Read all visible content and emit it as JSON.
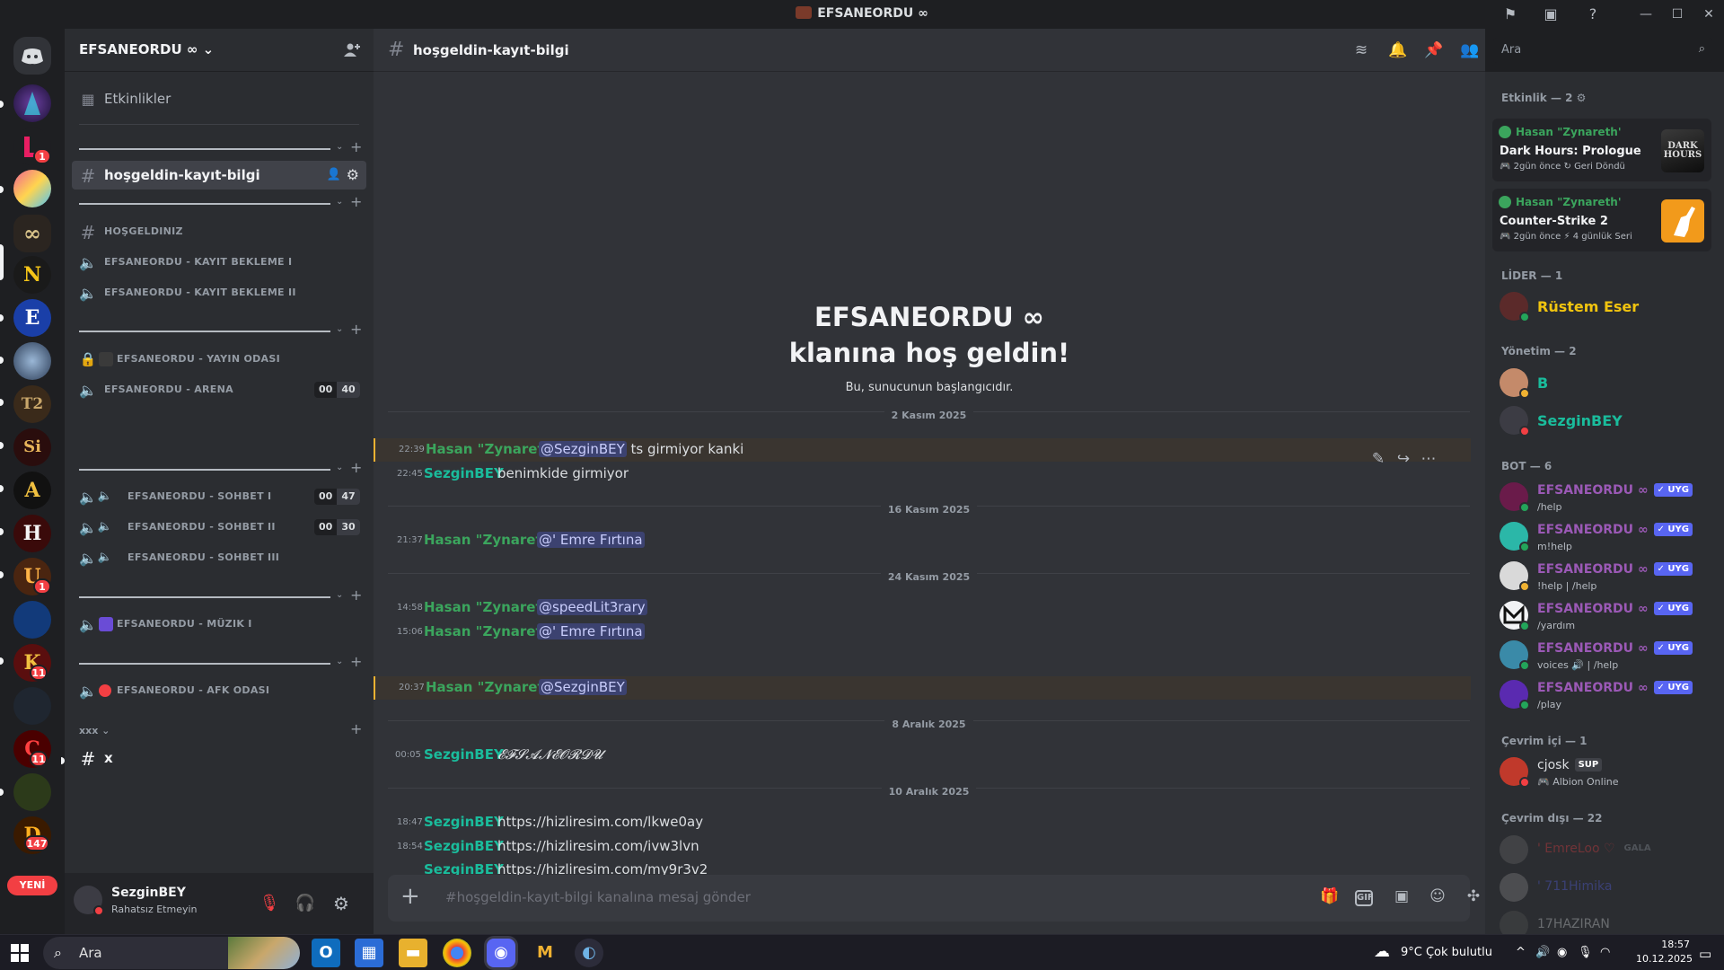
{
  "app": {
    "title": "EFSANEORDU ∞"
  },
  "server": {
    "name": "EFSANEORDU ∞"
  },
  "sidebar": {
    "events_label": "Etkinlikler",
    "selected_channel": "hoşgeldin-kayıt-bilgi",
    "channels": {
      "c1": "HOŞGELDINIZ",
      "c2": "EFSANEORDU - KAYIT BEKLEME I",
      "c3": "EFSANEORDU - KAYIT BEKLEME II",
      "c4": "EFSANEORDU - YAYIN ODASI",
      "c5": "EFSANEORDU - ARENA",
      "c6": "EFSANEORDU - SOHBET I",
      "c7": "EFSANEORDU - SOHBET II",
      "c8": "EFSANEORDU - SOHBET III",
      "c9": "EFSANEORDU - MÜZIK I",
      "c10": "EFSANEORDU - AFK ODASI",
      "c11": "x"
    },
    "counts": {
      "arena": [
        "00",
        "40"
      ],
      "sohbet1": [
        "00",
        "47"
      ],
      "sohbet2": [
        "00",
        "30"
      ]
    },
    "category_xxx": "xxx",
    "yeni_label": "YENİ"
  },
  "guild_badges": {
    "b1": "1",
    "b2": "1",
    "b3": "11",
    "b4": "11",
    "b5": "147"
  },
  "guild_letters": {
    "g1": "N",
    "g2": "E",
    "g3": "T2",
    "g4": "Si",
    "g5": "A",
    "g6": "H",
    "g7": "U",
    "g8": "K",
    "g9": "C",
    "g10": "D"
  },
  "user_panel": {
    "name": "SezginBEY",
    "status": "Rahatsız Etmeyin"
  },
  "channel_header": {
    "name": "hoşgeldin-kayıt-bilgi"
  },
  "search": {
    "placeholder": "Ara"
  },
  "welcome": {
    "line1": "EFSANEORDU ∞",
    "line2": "klanına hoş geldin!",
    "sub": "Bu, sunucunun başlangıcıdır."
  },
  "dates": {
    "d1": "2 Kasım 2025",
    "d2": "16 Kasım 2025",
    "d3": "24 Kasım 2025",
    "d4": "8 Aralık 2025",
    "d5": "10 Aralık 2025"
  },
  "messages": [
    {
      "time": "22:39",
      "author": "Hasan \"Zynareth'",
      "mention": "@SezginBEY",
      "text": "ts girmiyor kanki"
    },
    {
      "time": "22:45",
      "author": "SezginBEY",
      "text": "benimkide girmiyor"
    },
    {
      "time": "21:37",
      "author": "Hasan \"Zynareth'",
      "mention": "@' Emre Fırtına"
    },
    {
      "time": "14:58",
      "author": "Hasan \"Zynareth'",
      "mention": "@speedLit3rary"
    },
    {
      "time": "15:06",
      "author": "Hasan \"Zynareth'",
      "mention": "@' Emre Fırtına"
    },
    {
      "time": "20:37",
      "author": "Hasan \"Zynareth'",
      "mention": "@SezginBEY"
    },
    {
      "time": "00:05",
      "author": "SezginBEY",
      "text": "𝓔𝓕𝓢𝓐𝓝𝓔𝓞𝓡𝓓𝓤"
    },
    {
      "time": "18:47",
      "author": "SezginBEY",
      "link": "https://hizliresim.com/lkwe0ay"
    },
    {
      "time": "18:54",
      "author": "SezginBEY",
      "link": "https://hizliresim.com/ivw3lvn"
    },
    {
      "time": "",
      "author": "SezginBEY",
      "link": "https://hizliresim.com/my9r3v2"
    }
  ],
  "composer": {
    "placeholder": "#hoşgeldin-kayıt-bilgi kanalına mesaj gönder"
  },
  "members": {
    "activity_header": "Etkinlik — 2",
    "activities": [
      {
        "user": "Hasan \"Zynareth'",
        "game": "Dark Hours: Prologue",
        "meta1": "2gün önce",
        "meta2": "Geri Döndü",
        "art": "DARK HOURS"
      },
      {
        "user": "Hasan \"Zynareth'",
        "game": "Counter-Strike 2",
        "meta1": "2gün önce",
        "meta2": "4 günlük Seri"
      }
    ],
    "lider_header": "LİDER — 1",
    "lider": "Rüstem Eser",
    "yonetim_header": "Yönetim — 2",
    "yonetim": [
      "B",
      "SezginBEY"
    ],
    "bot_header": "BOT — 6",
    "bot_name": "EFSANEORDU ∞",
    "bot_tag": "✓ UYG",
    "bots": [
      "/help",
      "m!help",
      "!help | /help",
      "/yardım",
      "voices 🔊 | /help",
      "/play"
    ],
    "online_header": "Çevrim içi — 1",
    "online_name": "cjosk",
    "online_tag": "SUP",
    "online_activity": "Albion Online",
    "offline_header": "Çevrim dışı — 22",
    "offline": [
      "' EmreLoo ♡",
      "' 711Himika",
      "17HAZIRAN"
    ],
    "offline_tag": "GALA"
  },
  "taskbar": {
    "search_placeholder": "Ara",
    "weather": "9°C  Çok bulutlu",
    "time": "18:57",
    "date": "10.12.2025"
  },
  "colors": {
    "hasan": "#3ba55d",
    "sezgin": "#1abc9c",
    "lider": "#f1c40f",
    "bot": "#9b59b6",
    "blurple": "#5865f2"
  }
}
